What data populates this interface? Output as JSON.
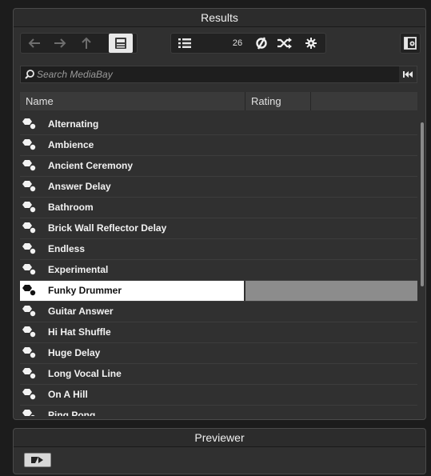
{
  "results": {
    "title": "Results",
    "result_count": "26",
    "search": {
      "placeholder": "Search MediaBay",
      "value": ""
    },
    "columns": [
      "Name",
      "Rating",
      ""
    ],
    "items": [
      "Alternating",
      "Ambience",
      "Ancient Ceremony",
      "Answer Delay",
      "Bathroom",
      "Brick Wall Reflector Delay",
      "Endless",
      "Experimental",
      "Funky Drummer",
      "Guitar Answer",
      "Hi Hat Shuffle",
      "Huge Delay",
      "Long Vocal Line",
      "On A Hill",
      "Ping Pong"
    ],
    "selected_index": 8
  },
  "previewer": {
    "title": "Previewer"
  },
  "icons": {
    "back": "arrow-left-icon",
    "forward": "arrow-right-icon",
    "up": "arrow-up-icon",
    "folder": "folder-icon",
    "list": "list-icon",
    "refresh": "refresh-icon",
    "shuffle": "shuffle-icon",
    "settings": "gear-icon",
    "setup": "panel-settings-icon",
    "search": "search-icon",
    "reset": "rewind-icon",
    "preset": "preset-icon",
    "autoplay": "autoplay-icon"
  },
  "colors": {
    "selected_row": "#ffffff",
    "selected_rating": "#8c8c8c",
    "panel": "#303030"
  }
}
